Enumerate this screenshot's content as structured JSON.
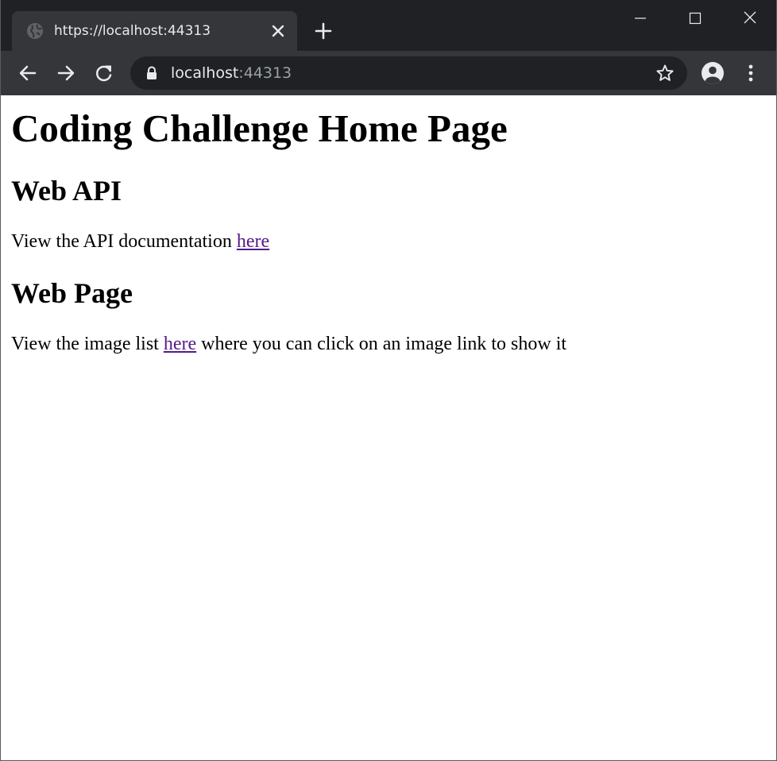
{
  "browser": {
    "tab": {
      "title": "https://localhost:44313",
      "favicon": "globe-icon"
    },
    "address_bar": {
      "host": "localhost",
      "port": ":44313"
    },
    "icons": {
      "back": "back-arrow-icon",
      "forward": "forward-arrow-icon",
      "reload": "reload-icon",
      "lock": "lock-icon",
      "bookmark": "star-icon",
      "profile": "account-icon",
      "menu": "kebab-menu-icon",
      "new_tab": "plus-icon",
      "minimize": "minimize-icon",
      "maximize": "maximize-icon",
      "close": "close-icon"
    },
    "colors": {
      "tabstrip": "#202124",
      "toolbar": "#35363a",
      "omnibox": "#202124",
      "text": "#e8eaed",
      "muted_text": "#9aa0a6",
      "visited_link": "#551a8b"
    }
  },
  "page": {
    "title": "Coding Challenge Home Page",
    "web_api": {
      "heading": "Web API",
      "text_before": "View the API documentation ",
      "link_label": "here"
    },
    "web_page": {
      "heading": "Web Page",
      "text_before": "View the image list ",
      "link_label": "here",
      "text_after": " where you can click on an image link to show it"
    }
  }
}
